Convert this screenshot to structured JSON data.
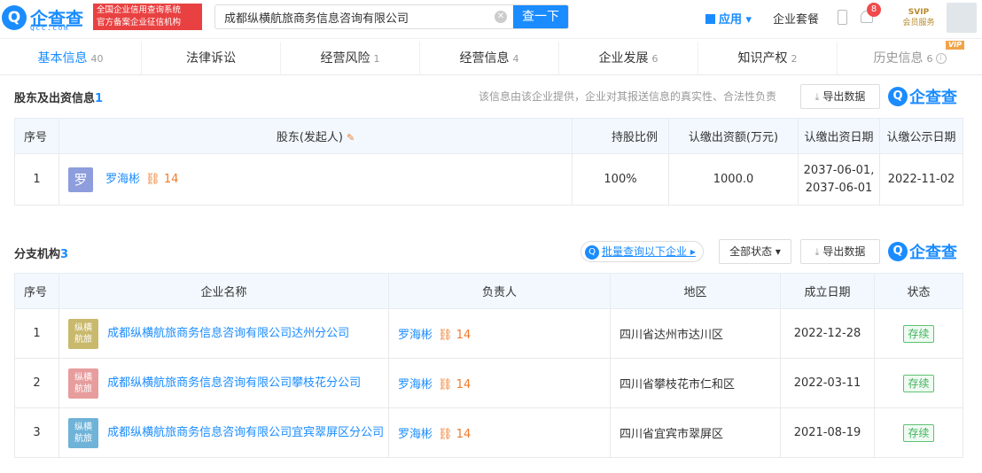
{
  "header": {
    "logo_mark": "Q",
    "logo_text": "企查查",
    "logo_sub": "Qcc.com",
    "slogan_line1": "全国企业信用查询系统",
    "slogan_line2": "官方备案企业征信机构",
    "search_value": "成都纵横航旅商务信息咨询有限公司",
    "search_button": "查一下",
    "app_label": "应用",
    "package_label": "企业套餐",
    "notification_count": "8",
    "svip_title": "SVIP",
    "svip_sub": "会员服务"
  },
  "tabs": [
    {
      "label": "基本信息",
      "count": "40"
    },
    {
      "label": "法律诉讼",
      "count": ""
    },
    {
      "label": "经营风险",
      "count": "1"
    },
    {
      "label": "经营信息",
      "count": "4"
    },
    {
      "label": "企业发展",
      "count": "6"
    },
    {
      "label": "知识产权",
      "count": "2"
    },
    {
      "label": "历史信息",
      "count": "6",
      "badge": "VIP"
    }
  ],
  "shareholders": {
    "title": "股东及出资信息",
    "count": "1",
    "disclaimer": "该信息由该企业提供，企业对其报送信息的真实性、合法性负责",
    "export_label": "导出数据",
    "brand": "企查查",
    "columns": [
      "序号",
      "股东(发起人)",
      "持股比例",
      "认缴出资额(万元)",
      "认缴出资日期",
      "认缴公示日期"
    ],
    "rows": [
      {
        "index": "1",
        "avatar": "罗",
        "name": "罗海彬",
        "relations": "14",
        "ratio": "100%",
        "amount": "1000.0",
        "date1": "2037-06-01,",
        "date2": "2037-06-01",
        "public_date": "2022-11-02"
      }
    ]
  },
  "branches": {
    "title": "分支机构",
    "count": "3",
    "batch_label": "批量查询以下企业",
    "status_filter": "全部状态",
    "export_label": "导出数据",
    "brand": "企查查",
    "columns": [
      "序号",
      "企业名称",
      "负责人",
      "地区",
      "成立日期",
      "状态"
    ],
    "rows": [
      {
        "index": "1",
        "logo_line1": "纵横",
        "logo_line2": "航旅",
        "logo_color": "#c9b96c",
        "name": "成都纵横航旅商务信息咨询有限公司达州分公司",
        "person": "罗海彬",
        "relations": "14",
        "region": "四川省达州市达川区",
        "date": "2022-12-28",
        "status": "存续"
      },
      {
        "index": "2",
        "logo_line1": "纵横",
        "logo_line2": "航旅",
        "logo_color": "#e79d9d",
        "name": "成都纵横航旅商务信息咨询有限公司攀枝花分公司",
        "person": "罗海彬",
        "relations": "14",
        "region": "四川省攀枝花市仁和区",
        "date": "2022-03-11",
        "status": "存续"
      },
      {
        "index": "3",
        "logo_line1": "纵横",
        "logo_line2": "航旅",
        "logo_color": "#6fb3d8",
        "name": "成都纵横航旅商务信息咨询有限公司宜宾翠屏区分公司",
        "person": "罗海彬",
        "relations": "14",
        "region": "四川省宜宾市翠屏区",
        "date": "2021-08-19",
        "status": "存续"
      }
    ]
  }
}
